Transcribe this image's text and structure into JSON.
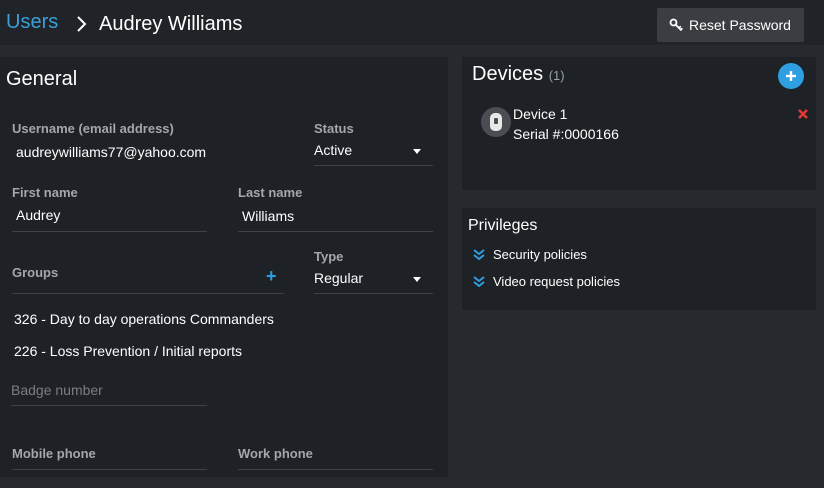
{
  "breadcrumb": {
    "root": "Users",
    "current": "Audrey Williams"
  },
  "header": {
    "reset_password_label": "Reset Password"
  },
  "general": {
    "title": "General",
    "username_label": "Username (email address)",
    "username_value": "audreywilliams77@yahoo.com",
    "status_label": "Status",
    "status_value": "Active",
    "first_name_label": "First name",
    "first_name_value": "Audrey",
    "last_name_label": "Last name",
    "last_name_value": "Williams",
    "groups_label": "Groups",
    "type_label": "Type",
    "type_value": "Regular",
    "groups": [
      "326 - Day to day operations Commanders",
      "226 - Loss Prevention / Initial reports"
    ],
    "badge_placeholder": "Badge number",
    "mobile_label": "Mobile phone",
    "work_label": "Work phone"
  },
  "devices": {
    "title": "Devices",
    "count": "(1)",
    "items": [
      {
        "name": "Device 1",
        "serial": "Serial #:0000166"
      }
    ]
  },
  "privileges": {
    "title": "Privileges",
    "items": [
      "Security policies",
      "Video request policies"
    ]
  },
  "colors": {
    "accent": "#2e9fe0",
    "link": "#3aa0d8",
    "danger": "#e53935",
    "panel": "#1e2125",
    "background": "#26292e"
  },
  "icons": {
    "chevron": "chevron-right-icon",
    "key": "key-icon",
    "add": "plus-icon",
    "remove": "close-icon",
    "device": "camera-device-icon",
    "expand": "double-chevron-down-icon"
  }
}
